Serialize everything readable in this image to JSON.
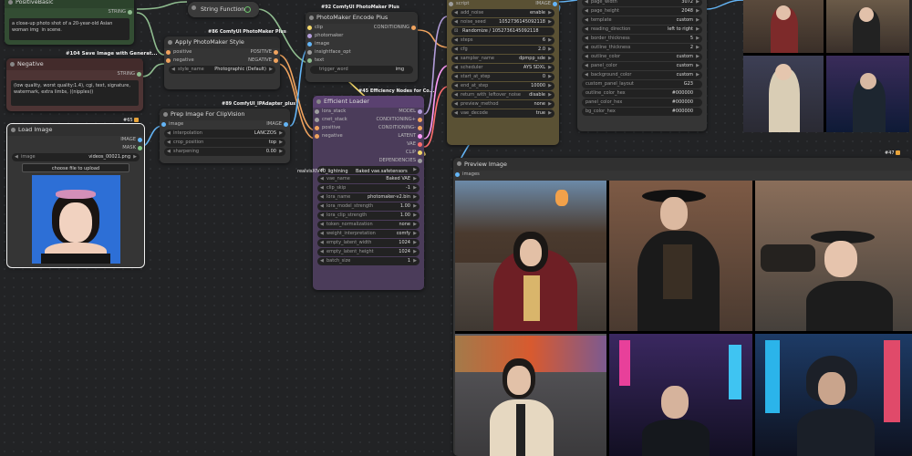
{
  "nodes": {
    "positive_basic": {
      "title": "PositiveBasic",
      "output": "STRING",
      "prompt": "a close-up photo shot of a 20-year-old Asian woman img  in scene."
    },
    "negative": {
      "title": "Negative",
      "output": "STRING",
      "prompt": "(low quality, worst quality:1.4), cgi, text, signature, watermark, extra limbs, ((nipples))"
    },
    "load_image": {
      "title": "Load Image",
      "badge": "#65",
      "outputs": [
        "IMAGE",
        "MASK"
      ],
      "image_label": "image",
      "image_value": "videos_00021.png",
      "upload_label": "choose file to upload"
    },
    "string_function": {
      "title": "String Function"
    },
    "apply_photomaker": {
      "title": "Apply PhotoMaker Style",
      "badge": "#86 ComfyUI PhotoMaker Plus",
      "inputs": [
        "positive",
        "negative"
      ],
      "outputs": [
        "POSITIVE",
        "NEGATIVE"
      ],
      "style_label": "style_name",
      "style_value": "Photographic (Default)"
    },
    "save_image_label": "#104 Save Image with Generat...",
    "photomaker_encode": {
      "title": "PhotoMaker Encode Plus",
      "badge": "#92 ComfyUI PhotoMaker Plus",
      "inputs": [
        "clip",
        "photomaker",
        "image",
        "insightface_opt",
        "text"
      ],
      "output": "CONDITIONING",
      "trigger_label": "trigger_word",
      "trigger_value": "img"
    },
    "prep_image": {
      "title": "Prep Image For ClipVision",
      "badge": "#89 ComfyUI_IPAdapter_plus",
      "input": "image",
      "output": "IMAGE",
      "widgets": [
        {
          "k": "interpolation",
          "v": "LANCZOS"
        },
        {
          "k": "crop_position",
          "v": "top"
        },
        {
          "k": "sharpening",
          "v": "0.00"
        }
      ]
    },
    "efficient_loader": {
      "title": "Efficient Loader",
      "badge": "#45 Efficiency Nodes for Co...",
      "inputs": [
        "lora_stack",
        "cnet_stack",
        "positive",
        "negative"
      ],
      "outputs": [
        "MODEL",
        "CONDITIONING+",
        "CONDITIONING-",
        "LATENT",
        "VAE",
        "CLIP",
        "DEPENDENCIES"
      ],
      "widgets": [
        {
          "k": "ckpt_name",
          "v": "realvisxl/V40_lightning.safetensors"
        },
        {
          "k": "vae_name",
          "v": "Baked VAE"
        },
        {
          "k": "clip_skip",
          "v": "-1"
        },
        {
          "k": "lora_name",
          "v": "photomaker-v2.bin"
        },
        {
          "k": "lora_model_strength",
          "v": "1.00"
        },
        {
          "k": "lora_clip_strength",
          "v": "1.00"
        },
        {
          "k": "token_normalization",
          "v": "none"
        },
        {
          "k": "weight_interpretation",
          "v": "comfy"
        },
        {
          "k": "empty_latent_width",
          "v": "1024"
        },
        {
          "k": "empty_latent_height",
          "v": "1024"
        },
        {
          "k": "batch_size",
          "v": "1"
        }
      ],
      "overlap_label": "realvisXlV40_lightning",
      "overlap_label2": "Baked vae.safetensors"
    },
    "sampler": {
      "badge": "#47",
      "label_script": "script",
      "out_image": "IMAGE",
      "widgets": [
        {
          "k": "add_noise",
          "v": "enable"
        },
        {
          "k": "noise_seed",
          "v": "1052736145092118"
        },
        {
          "k": "seed_ctrl",
          "v": "Randomize / 1052736145092118"
        },
        {
          "k": "steps",
          "v": "6"
        },
        {
          "k": "cfg",
          "v": "2.0"
        },
        {
          "k": "sampler_name",
          "v": "dpmpp_sde"
        },
        {
          "k": "scheduler",
          "v": "AYS SDXL"
        },
        {
          "k": "start_at_step",
          "v": "0"
        },
        {
          "k": "end_at_step",
          "v": "10000"
        },
        {
          "k": "return_with_leftover_noise",
          "v": "disable"
        },
        {
          "k": "preview_method",
          "v": "none"
        },
        {
          "k": "vae_decode",
          "v": "true"
        }
      ]
    },
    "grid": {
      "widgets": [
        {
          "k": "page_width",
          "v": "3072"
        },
        {
          "k": "page_height",
          "v": "2048"
        },
        {
          "k": "template",
          "v": "custom"
        },
        {
          "k": "reading_direction",
          "v": "left to right"
        },
        {
          "k": "border_thickness",
          "v": "5"
        },
        {
          "k": "outline_thickness",
          "v": "2"
        },
        {
          "k": "outline_color",
          "v": "custom"
        },
        {
          "k": "panel_color",
          "v": "custom"
        },
        {
          "k": "background_color",
          "v": "custom"
        },
        {
          "k": "custom_panel_layout",
          "v": "G23"
        },
        {
          "k": "outline_color_hex",
          "v": "#000000"
        },
        {
          "k": "panel_color_hex",
          "v": "#000000"
        },
        {
          "k": "bg_color_hex",
          "v": "#000000"
        }
      ]
    },
    "preview": {
      "title": "Preview Image",
      "badge": "#47",
      "input": "images"
    }
  },
  "colors": {
    "clip": "#f4d86b",
    "conditioning": "#f0a35e",
    "image": "#64b5f6",
    "model": "#b39ddb",
    "vae": "#ff6e6e",
    "latent": "#ff9cf9",
    "string": "#8fbc8f"
  },
  "icons": [
    "string-function-icon",
    "seed-dice-icon"
  ]
}
